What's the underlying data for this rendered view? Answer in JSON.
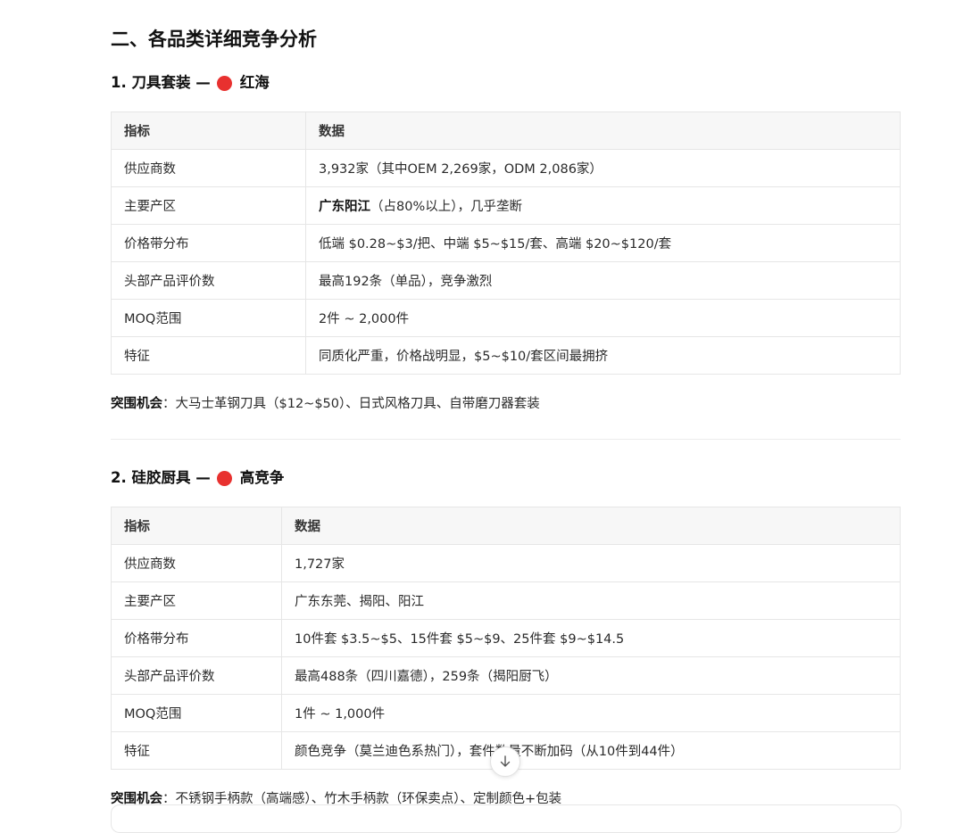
{
  "section_title": "二、各品类详细竞争分析",
  "categories": [
    {
      "title": "1. 刀具套装 —",
      "level": "红海",
      "table": {
        "headers": [
          "指标",
          "数据"
        ],
        "rows": [
          [
            "供应商数",
            "3,932家（其中OEM 2,269家，ODM 2,086家）"
          ],
          [
            "主要产区",
            "广东阳江",
            "（占80%以上），几乎垄断"
          ],
          [
            "价格带分布",
            "低端 $0.28~$3/把、中端 $5~$15/套、高端 $20~$120/套"
          ],
          [
            "头部产品评价数",
            "最高192条（单品），竞争激烈"
          ],
          [
            "MOQ范围",
            "2件 ~ 2,000件"
          ],
          [
            "特征",
            "同质化严重，价格战明显，$5~$10/套区间最拥挤"
          ]
        ]
      },
      "opportunity_label": "突围机会",
      "opportunity_text": "：大马士革钢刀具（$12~$50）、日式风格刀具、自带磨刀器套装"
    },
    {
      "title": "2. 硅胶厨具 —",
      "level": "高竞争",
      "table": {
        "headers": [
          "指标",
          "数据"
        ],
        "rows": [
          [
            "供应商数",
            "1,727家"
          ],
          [
            "主要产区",
            "广东东莞、揭阳、阳江"
          ],
          [
            "价格带分布",
            "10件套 $3.5~$5、15件套 $5~$9、25件套 $9~$14.5"
          ],
          [
            "头部产品评价数",
            "最高488条（四川嘉德），259条（揭阳厨飞）"
          ],
          [
            "MOQ范围",
            "1件 ~ 1,000件"
          ],
          [
            "特征",
            "颜色竞争（莫兰迪色系热门），套件数量不断加码（从10件到44件）"
          ]
        ]
      },
      "opportunity_label": "突围机会",
      "opportunity_text": "：不锈钢手柄款（高端感）、竹木手柄款（环保卖点）、定制颜色+包装"
    }
  ],
  "colors": {
    "red_dot": "#e8312f",
    "header_bg": "#f7f7f7",
    "border": "#e6e6e6"
  },
  "scroll_button_icon": "arrow-down-icon"
}
